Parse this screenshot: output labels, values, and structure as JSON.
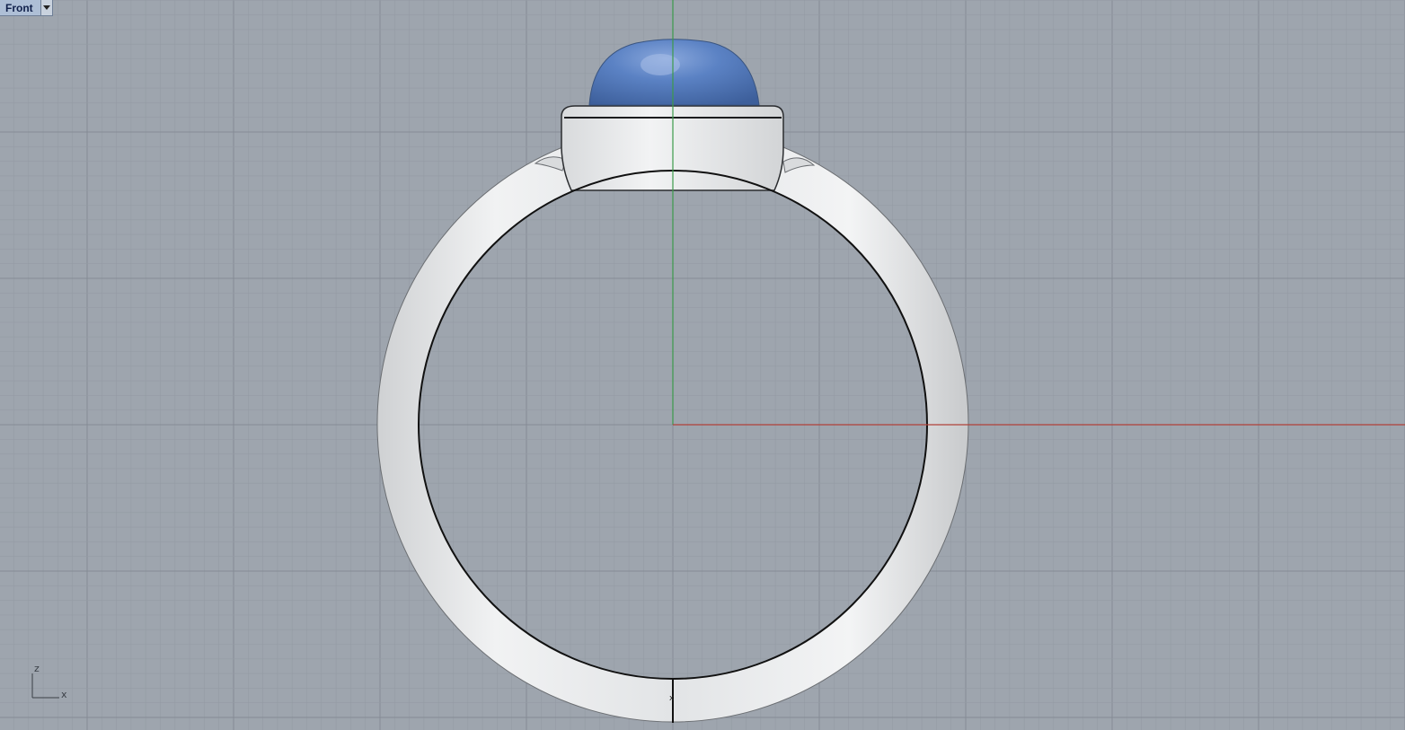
{
  "viewport": {
    "name": "Front",
    "dropdown_icon": "chevron-down-icon",
    "background": "#9ea5ae",
    "grid_minor_color": "#949ba4",
    "grid_major_color": "#858c95"
  },
  "axes": {
    "x_axis_color": "#b0423a",
    "y_axis_color": "#3c9a4a",
    "indicator": {
      "x_label": "x",
      "z_label": "z"
    }
  },
  "model": {
    "object": "ring",
    "metal_color": "#e6e7e8",
    "gem_color": "#5b82c4",
    "gem_shape": "cabochon"
  }
}
